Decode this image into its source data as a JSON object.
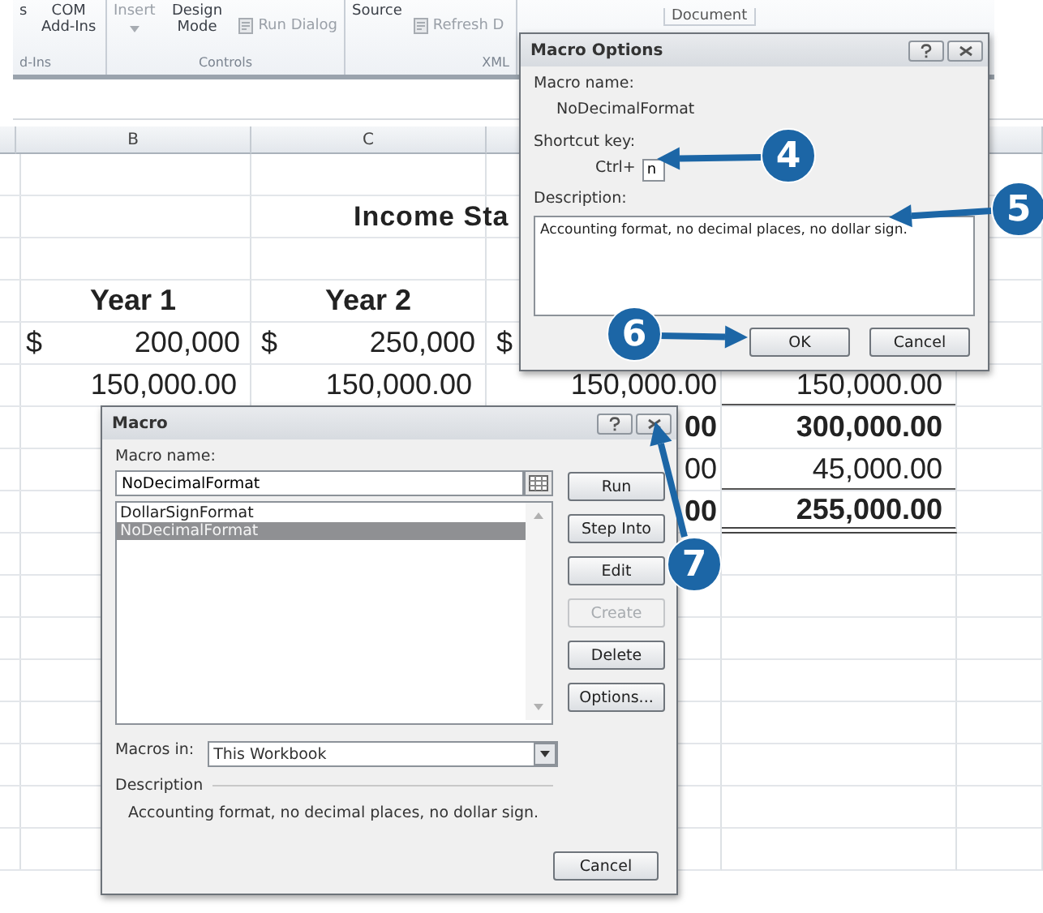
{
  "ribbon": {
    "groups": [
      {
        "label": "d-Ins",
        "items": [
          {
            "label": "s",
            "kind": "large",
            "disabled": false
          },
          {
            "label": "COM Add-Ins",
            "kind": "large",
            "disabled": false
          }
        ]
      },
      {
        "label": "Controls",
        "items": [
          {
            "label": "Insert",
            "kind": "dropdown",
            "disabled": true
          },
          {
            "label": "Design Mode",
            "kind": "large",
            "disabled": false
          },
          {
            "label": "Run Dialog",
            "kind": "small",
            "disabled": true
          }
        ]
      },
      {
        "label": "XML",
        "items": [
          {
            "label": "Source",
            "kind": "large",
            "disabled": false
          },
          {
            "label": "Refresh D",
            "kind": "small",
            "disabled": true
          }
        ]
      }
    ],
    "document_label": "Document"
  },
  "sheet": {
    "columns": [
      "B",
      "C"
    ],
    "rows": [
      {
        "kind": "blank"
      },
      {
        "kind": "title",
        "text": "Income Sta"
      },
      {
        "kind": "blank"
      },
      {
        "kind": "header",
        "cells": [
          "Year 1",
          "Year 2"
        ]
      },
      {
        "kind": "currency",
        "cells": [
          {
            "sign": "$",
            "value": "200,000"
          },
          {
            "sign": "$",
            "value": "250,000"
          },
          {
            "sign": "$"
          }
        ]
      },
      {
        "kind": "amount",
        "bold": false,
        "underlined": true,
        "double_underlined": false,
        "cells": [
          "150,000.00",
          "150,000.00",
          "150,000.00",
          "150,000.00"
        ]
      },
      {
        "kind": "amount",
        "bold": true,
        "underlined": false,
        "double_underlined": false,
        "cells": [
          null,
          null,
          "00",
          "300,000.00"
        ]
      },
      {
        "kind": "amount",
        "bold": false,
        "underlined": true,
        "double_underlined": false,
        "cells": [
          null,
          null,
          "00",
          "45,000.00"
        ]
      },
      {
        "kind": "amount",
        "bold": true,
        "underlined": false,
        "double_underlined": true,
        "cells": [
          null,
          null,
          "00",
          "255,000.00"
        ]
      }
    ]
  },
  "macro_options": {
    "title": "Macro Options",
    "macro_name_label": "Macro name:",
    "macro_name": "NoDecimalFormat",
    "shortcut_label": "Shortcut key:",
    "ctrl_label": "Ctrl+",
    "shortcut_value": "n",
    "description_label": "Description:",
    "description": "Accounting format, no decimal places, no dollar sign.",
    "buttons": [
      "OK",
      "Cancel"
    ]
  },
  "macro_dialog": {
    "title": "Macro",
    "macro_name_label": "Macro name:",
    "macro_name": "NoDecimalFormat",
    "macros": [
      {
        "name": "DollarSignFormat",
        "selected": false
      },
      {
        "name": "NoDecimalFormat",
        "selected": true
      }
    ],
    "buttons": [
      {
        "label": "Run",
        "disabled": false
      },
      {
        "label": "Step Into",
        "disabled": false
      },
      {
        "label": "Edit",
        "disabled": false
      },
      {
        "label": "Create",
        "disabled": true
      },
      {
        "label": "Delete",
        "disabled": false
      },
      {
        "label": "Options...",
        "disabled": false
      }
    ],
    "macros_in_label": "Macros in:",
    "macros_in": "This Workbook",
    "description_label": "Description",
    "description": "Accounting format, no decimal places, no dollar sign.",
    "cancel": "Cancel"
  },
  "callouts": [
    {
      "number": "4"
    },
    {
      "number": "5"
    },
    {
      "number": "6"
    },
    {
      "number": "7"
    }
  ]
}
